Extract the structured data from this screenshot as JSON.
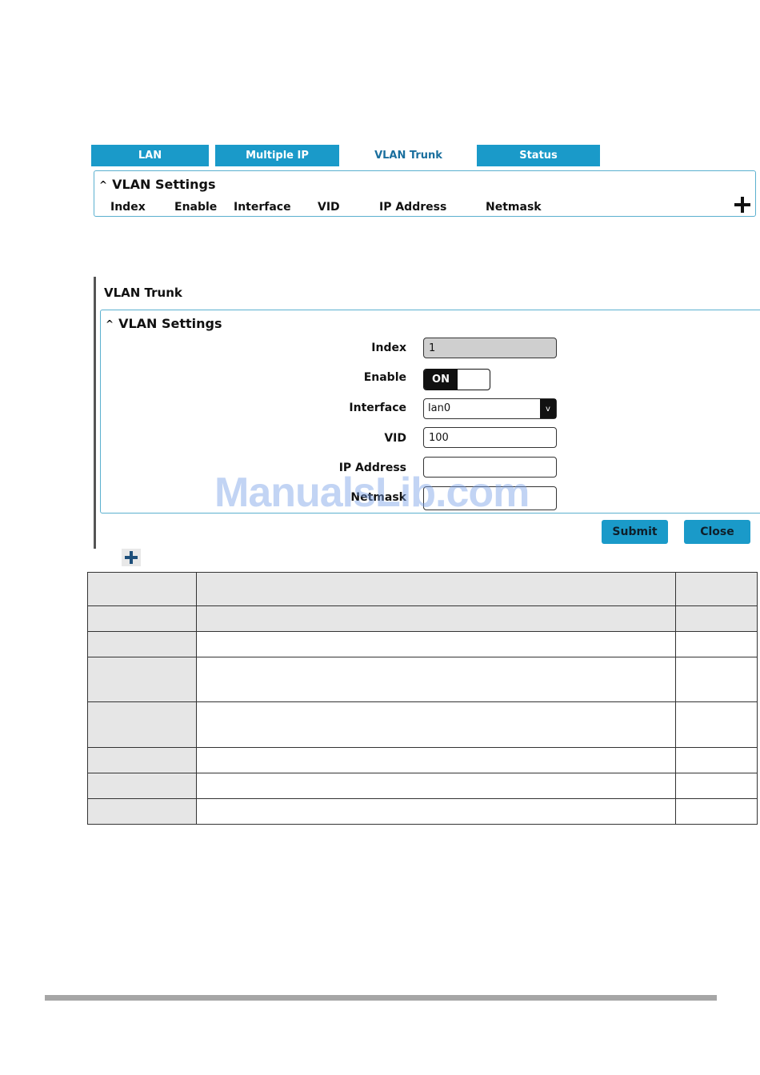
{
  "tabs": [
    "LAN",
    "Multiple IP",
    "VLAN Trunk",
    "Status"
  ],
  "list_panel": {
    "section_title": "VLAN Settings",
    "columns": [
      "Index",
      "Enable",
      "Interface",
      "VID",
      "IP Address",
      "Netmask"
    ]
  },
  "dialog": {
    "title": "VLAN Trunk",
    "section_title": "VLAN Settings",
    "fields": {
      "index_label": "Index",
      "index_value": "1",
      "enable_label": "Enable",
      "enable_state": "ON",
      "interface_label": "Interface",
      "interface_value": "lan0",
      "vid_label": "VID",
      "vid_value": "100",
      "ip_label": "IP Address",
      "ip_value": "",
      "netmask_label": "Netmask",
      "netmask_value": ""
    },
    "submit_label": "Submit",
    "close_label": "Close"
  },
  "watermark": "ManualsLib.com",
  "colors": {
    "tab_blue": "#1a9ac9",
    "panel_border": "#5bb0cf",
    "active_tab_text": "#1a6f9e"
  }
}
